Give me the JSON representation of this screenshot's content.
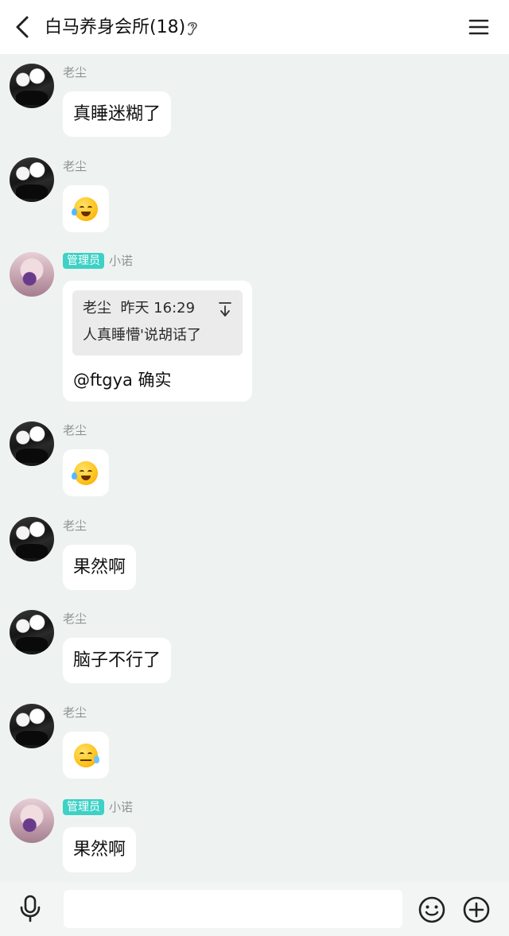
{
  "header": {
    "title": "白马养身会所(18)",
    "back_icon": "chevron-left-icon",
    "ear_icon": "ear-icon",
    "menu_icon": "hamburger-menu-icon"
  },
  "messages": [
    {
      "sender": "老尘",
      "text": "真睡迷糊了",
      "avatar": "avatar-laochen"
    },
    {
      "sender": "老尘",
      "emoji": "laugh-cry-emoji",
      "avatar": "avatar-laochen"
    },
    {
      "sender": "小诺",
      "badge": "管理员",
      "avatar": "avatar-xiaonuo",
      "quote": {
        "author": "老尘",
        "time": "昨天 16:29",
        "text": "人真睡懵'说胡话了"
      },
      "text": "@ftgya 确实"
    },
    {
      "sender": "老尘",
      "emoji": "laugh-cry-emoji",
      "avatar": "avatar-laochen"
    },
    {
      "sender": "老尘",
      "text": "果然啊",
      "avatar": "avatar-laochen"
    },
    {
      "sender": "老尘",
      "text": "脑子不行了",
      "avatar": "avatar-laochen"
    },
    {
      "sender": "老尘",
      "emoji": "sweat-emoji",
      "avatar": "avatar-laochen"
    },
    {
      "sender": "小诺",
      "badge": "管理员",
      "text": "果然啊",
      "avatar": "avatar-xiaonuo"
    }
  ],
  "input_bar": {
    "placeholder": "",
    "voice_icon": "microphone-icon",
    "emoji_icon": "smiley-icon",
    "more_icon": "plus-circle-icon"
  },
  "colors": {
    "background": "#eef3f1",
    "bubble": "#ffffff",
    "badge": "#3ed1c5",
    "sender_name": "#8d9592",
    "quote_bg": "#ebebeb"
  }
}
